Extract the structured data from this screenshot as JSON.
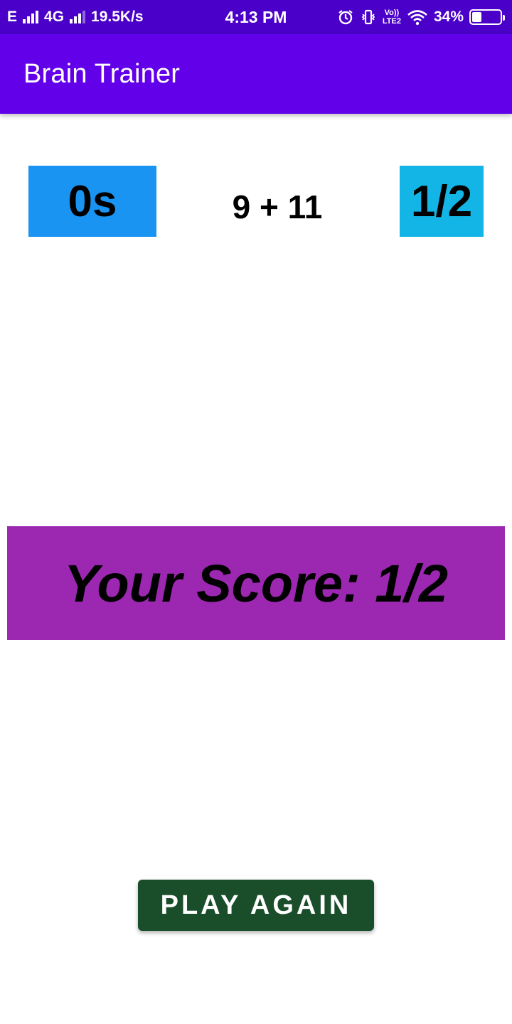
{
  "status_bar": {
    "network_e": "E",
    "network_4g": "4G",
    "speed": "19.5K/s",
    "time": "4:13 PM",
    "volte_top": "Vo))",
    "volte_bottom": "LTE2",
    "battery": "34%",
    "battery_level": 0.34,
    "icons": [
      "signal-icon",
      "alarm-icon",
      "vibrate-icon",
      "wifi-icon",
      "battery-icon"
    ]
  },
  "app_bar": {
    "title": "Brain Trainer"
  },
  "game": {
    "timer": "0s",
    "question": "9 + 11",
    "score": "1/2"
  },
  "result": {
    "text": "Your Score: 1/2"
  },
  "play_again": {
    "label": "PLAY AGAIN"
  },
  "colors": {
    "status_bar": "#4a00c8",
    "app_bar": "#6200ea",
    "timer_bg": "#1a94f2",
    "score_bg": "#12b5e6",
    "result_bg": "#9c27b0",
    "play_again_bg": "#1a4d2a"
  }
}
